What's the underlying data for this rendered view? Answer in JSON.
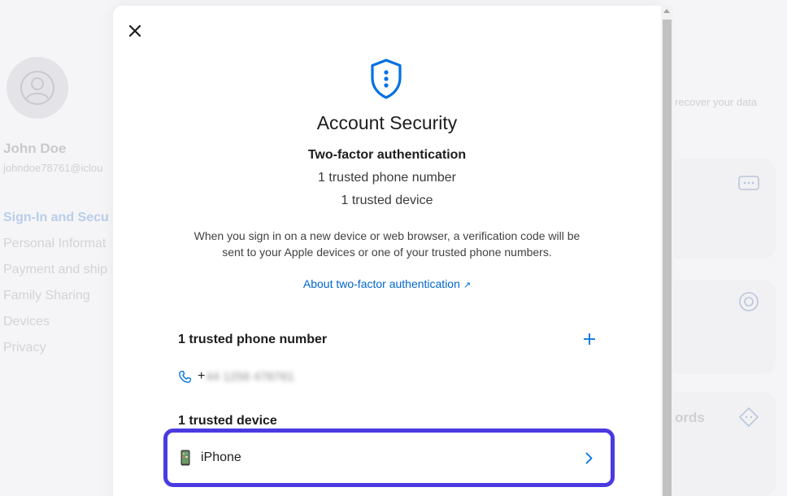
{
  "background": {
    "user_name": "John Doe",
    "user_email": "johndoe78761@iclou",
    "nav_items": [
      {
        "label": "Sign-In and Secu",
        "active": true
      },
      {
        "label": "Personal Informat",
        "active": false
      },
      {
        "label": "Payment and ship",
        "active": false
      },
      {
        "label": "Family Sharing",
        "active": false
      },
      {
        "label": "Devices",
        "active": false
      },
      {
        "label": "Privacy",
        "active": false
      }
    ],
    "right_text": "recover your data",
    "right_card_label": "ords"
  },
  "modal": {
    "title": "Account Security",
    "tfa_heading": "Two-factor authentication",
    "tfa_phone_summary": "1 trusted phone number",
    "tfa_device_summary": "1 trusted device",
    "description": "When you sign in on a new device or web browser, a verification code will be sent to your Apple devices or one of your trusted phone numbers.",
    "learn_more_link": "About two-factor authentication",
    "phone_section_title": "1 trusted phone number",
    "phone_prefix": "+",
    "phone_number_masked": "44 1256 478761",
    "device_section_title": "1 trusted device",
    "devices": [
      {
        "name": "iPhone"
      }
    ]
  },
  "colors": {
    "accent": "#0066cc",
    "highlight_outline": "#4a3ae0",
    "text": "#1d1d1f"
  },
  "icons": {
    "close": "close-icon",
    "shield": "shield-icon",
    "external_link": "arrow-up-right-icon",
    "add": "plus-icon",
    "phone": "phone-icon",
    "device": "iphone-icon",
    "chevron": "chevron-right-icon"
  }
}
